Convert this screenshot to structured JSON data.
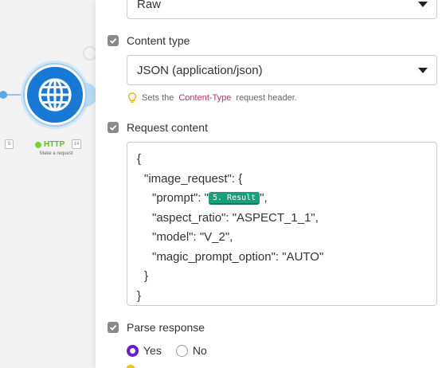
{
  "canvas": {
    "module_name": "HTTP",
    "module_subtitle": "Make a request",
    "left_tag": "5",
    "right_tag": "14",
    "icon": "globe-icon",
    "accent": "#1778d6",
    "status_color": "#7bd03c"
  },
  "panel": {
    "parse_body_select": {
      "value": "Raw"
    },
    "content_type": {
      "label": "Content type",
      "value": "JSON (application/json)",
      "hint_prefix": "Sets the",
      "hint_code": "Content-Type",
      "hint_suffix": "request header."
    },
    "request_content": {
      "label": "Request content",
      "lines": {
        "open_brace": "{",
        "image_request_key": "\"image_request\": {",
        "prompt_key": "\"prompt\": \"",
        "prompt_pill": "5. Result",
        "prompt_end": "\",",
        "aspect_ratio": "\"aspect_ratio\": \"ASPECT_1_1\",",
        "model": "\"model\": \"V_2\",",
        "magic_prompt_option": "\"magic_prompt_option\": \"AUTO\"",
        "inner_close": "}",
        "outer_close": "}"
      },
      "pill_color": "#17a07a"
    },
    "parse_response": {
      "label": "Parse response",
      "options": [
        "Yes",
        "No"
      ],
      "selected": "Yes",
      "radio_color": "#6a1bd1"
    }
  }
}
